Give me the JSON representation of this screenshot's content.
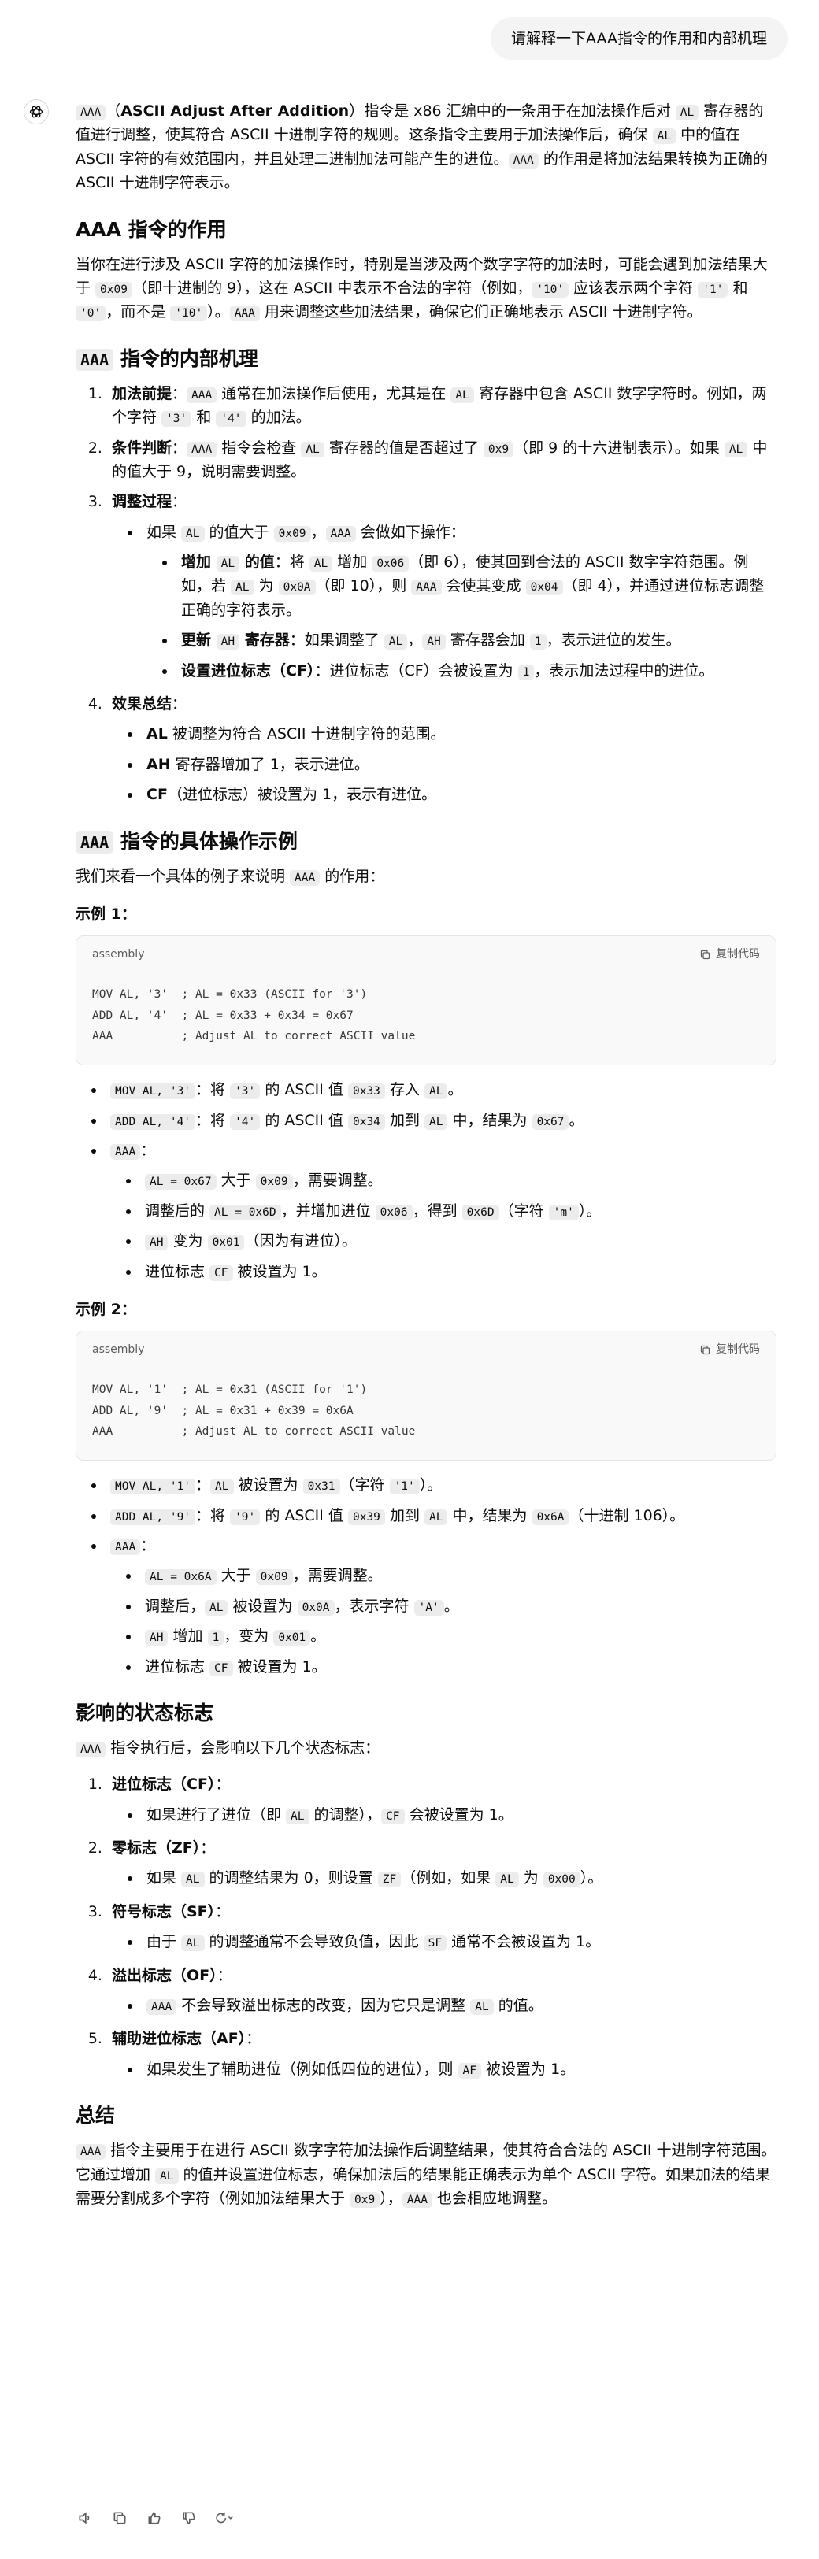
{
  "user_message": "请解释一下AAA指令的作用和内部机理",
  "intro": {
    "code": "AAA",
    "p1": "（",
    "bold": "ASCII Adjust After Addition",
    "p2": "）指令是 x86 汇编中的一条用于在加法操作后对 ",
    "code_al": "AL",
    "p3": " 寄存器的值进行调整，使其符合 ASCII 十进制字符的规则。这条指令主要用于加法操作后，确保 ",
    "code_al2": "AL",
    "p4": " 中的值在 ASCII 字符的有效范围内，并且处理二进制加法可能产生的进位。",
    "code_aaa": "AAA",
    "p5": " 的作用是将加法结果转换为正确的 ASCII 十进制字符表示。"
  },
  "section_role": {
    "title": "AAA 指令的作用",
    "t1": "当你在进行涉及 ASCII 字符的加法操作时，特别是当涉及两个数字字符的加法时，可能会遇到加法结果大于 ",
    "c1": "0x09",
    "t2": "（即十进制的 9），这在 ASCII 中表示不合法的字符（例如，",
    "c2": "'10'",
    "t3": " 应该表示两个字符 ",
    "c3": "'1'",
    "t4": " 和 ",
    "c4": "'0'",
    "t5": "，而不是 ",
    "c5": "'10'",
    "t6": "）。",
    "c6": "AAA",
    "t7": " 用来调整这些加法结果，确保它们正确地表示 ASCII 十进制字符。"
  },
  "section_mech": {
    "title_code": "AAA",
    "title_text": " 指令的内部机理",
    "item1": {
      "bold": "加法前提",
      "t1": "：",
      "c1": "AAA",
      "t2": " 通常在加法操作后使用，尤其是在 ",
      "c2": "AL",
      "t3": " 寄存器中包含 ASCII 数字字符时。例如，两个字符 ",
      "c3": "'3'",
      "t4": " 和 ",
      "c4": "'4'",
      "t5": " 的加法。"
    },
    "item2": {
      "bold": "条件判断",
      "t1": "：",
      "c1": "AAA",
      "t2": " 指令会检查 ",
      "c2": "AL",
      "t3": " 寄存器的值是否超过了 ",
      "c3": "0x9",
      "t4": "（即 9 的十六进制表示）。如果 ",
      "c4": "AL",
      "t5": " 中的值大于 9，说明需要调整。"
    },
    "item3": {
      "bold": "调整过程",
      "t1": "：",
      "sub": {
        "t1": "如果 ",
        "c1": "AL",
        "t2": " 的值大于 ",
        "c2": "0x09",
        "t3": "，",
        "c3": "AAA",
        "t4": " 会做如下操作："
      },
      "s1": {
        "b1": "增加 ",
        "bc": "AL",
        "b2": " 的值",
        "t1": "：将 ",
        "c1": "AL",
        "t2": " 增加 ",
        "c2": "0x06",
        "t3": "（即 6），使其回到合法的 ASCII 数字字符范围。例如，若 ",
        "c3": "AL",
        "t4": " 为 ",
        "c4": "0x0A",
        "t5": "（即 10），则 ",
        "c5": "AAA",
        "t6": " 会使其变成 ",
        "c6": "0x04",
        "t7": "（即 4），并通过进位标志调整正确的字符表示。"
      },
      "s2": {
        "b1": "更新 ",
        "bc": "AH",
        "b2": " 寄存器",
        "t1": "：如果调整了 ",
        "c1": "AL",
        "t2": "，",
        "c2": "AH",
        "t3": " 寄存器会加 ",
        "c3": "1",
        "t4": "，表示进位的发生。"
      },
      "s3": {
        "bold": "设置进位标志（CF）",
        "t1": "：进位标志（CF）会被设置为 ",
        "c1": "1",
        "t2": "，表示加法过程中的进位。"
      }
    },
    "item4": {
      "bold": "效果总结",
      "t1": "：",
      "s1": {
        "bold": "AL",
        "t": " 被调整为符合 ASCII 十进制字符的范围。"
      },
      "s2": {
        "bold": "AH",
        "t": " 寄存器增加了 1，表示进位。"
      },
      "s3": {
        "bold": "CF",
        "t": "（进位标志）被设置为 1，表示有进位。"
      }
    }
  },
  "section_example": {
    "title_code": "AAA",
    "title_text": " 指令的具体操作示例",
    "p1": "我们来看一个具体的例子来说明 ",
    "p1c": "AAA",
    "p2": " 的作用：",
    "ex1": {
      "label": "示例 1：",
      "lang": "assembly",
      "copy": "复制代码",
      "code": "MOV AL, '3'  ; AL = 0x33 (ASCII for '3')\nADD AL, '4'  ; AL = 0x33 + 0x34 = 0x67\nAAA          ; Adjust AL to correct ASCII value",
      "b1": {
        "c1": "MOV AL, '3'",
        "t1": "：将 ",
        "c2": "'3'",
        "t2": " 的 ASCII 值 ",
        "c3": "0x33",
        "t3": " 存入 ",
        "c4": "AL",
        "t4": "。"
      },
      "b2": {
        "c1": "ADD AL, '4'",
        "t1": "：将 ",
        "c2": "'4'",
        "t2": " 的 ASCII 值 ",
        "c3": "0x34",
        "t3": " 加到 ",
        "c4": "AL",
        "t4": " 中，结果为 ",
        "c5": "0x67",
        "t5": "。"
      },
      "b3": {
        "c1": "AAA",
        "t1": "："
      },
      "s1": {
        "c1": "AL = 0x67",
        "t1": " 大于 ",
        "c2": "0x09",
        "t2": "，需要调整。"
      },
      "s2": {
        "t0": "调整后的 ",
        "c1": "AL = 0x6D",
        "t1": "，并增加进位 ",
        "c2": "0x06",
        "t2": "，得到 ",
        "c3": "0x6D",
        "t3": "（字符 ",
        "c4": "'m'",
        "t4": "）。"
      },
      "s3": {
        "c1": "AH",
        "t1": " 变为 ",
        "c2": "0x01",
        "t2": "（因为有进位）。"
      },
      "s4": {
        "t0": "进位标志 ",
        "c1": "CF",
        "t1": " 被设置为 1。"
      }
    },
    "ex2": {
      "label": "示例 2：",
      "lang": "assembly",
      "copy": "复制代码",
      "code": "MOV AL, '1'  ; AL = 0x31 (ASCII for '1')\nADD AL, '9'  ; AL = 0x31 + 0x39 = 0x6A\nAAA          ; Adjust AL to correct ASCII value",
      "b1": {
        "c1": "MOV AL, '1'",
        "t1": "：",
        "c2": "AL",
        "t2": " 被设置为 ",
        "c3": "0x31",
        "t3": "（字符 ",
        "c4": "'1'",
        "t4": "）。"
      },
      "b2": {
        "c1": "ADD AL, '9'",
        "t1": "：将 ",
        "c2": "'9'",
        "t2": " 的 ASCII 值 ",
        "c3": "0x39",
        "t3": " 加到 ",
        "c4": "AL",
        "t4": " 中，结果为 ",
        "c5": "0x6A",
        "t5": "（十进制 106）。"
      },
      "b3": {
        "c1": "AAA",
        "t1": "："
      },
      "s1": {
        "c1": "AL = 0x6A",
        "t1": " 大于 ",
        "c2": "0x09",
        "t2": "，需要调整。"
      },
      "s2": {
        "t0": "调整后，",
        "c1": "AL",
        "t1": " 被设置为 ",
        "c2": "0x0A",
        "t2": "，表示字符 ",
        "c3": "'A'",
        "t3": "。"
      },
      "s3": {
        "c1": "AH",
        "t1": " 增加 ",
        "c2": "1",
        "t2": "，变为 ",
        "c3": "0x01",
        "t3": "。"
      },
      "s4": {
        "t0": "进位标志 ",
        "c1": "CF",
        "t1": " 被设置为 1。"
      }
    }
  },
  "section_flags": {
    "title": "影响的状态标志",
    "p_c": "AAA",
    "p_t": " 指令执行后，会影响以下几个状态标志：",
    "f1": {
      "bold": "进位标志（CF）",
      "t": "：",
      "s_t1": "如果进行了进位（即 ",
      "s_c1": "AL",
      "s_t2": " 的调整），",
      "s_c2": "CF",
      "s_t3": " 会被设置为 1。"
    },
    "f2": {
      "bold": "零标志（ZF）",
      "t": "：",
      "s_t1": "如果 ",
      "s_c1": "AL",
      "s_t2": " 的调整结果为 0，则设置 ",
      "s_c2": "ZF",
      "s_t3": "（例如，如果 ",
      "s_c3": "AL",
      "s_t4": " 为 ",
      "s_c4": "0x00",
      "s_t5": "）。"
    },
    "f3": {
      "bold": "符号标志（SF）",
      "t": "：",
      "s_t1": "由于 ",
      "s_c1": "AL",
      "s_t2": " 的调整通常不会导致负值，因此 ",
      "s_c2": "SF",
      "s_t3": " 通常不会被设置为 1。"
    },
    "f4": {
      "bold": "溢出标志（OF）",
      "t": "：",
      "s_c1": "AAA",
      "s_t1": " 不会导致溢出标志的改变，因为它只是调整 ",
      "s_c2": "AL",
      "s_t2": " 的值。"
    },
    "f5": {
      "bold": "辅助进位标志（AF）",
      "t": "：",
      "s_t1": "如果发生了辅助进位（例如低四位的进位），则 ",
      "s_c1": "AF",
      "s_t2": " 被设置为 1。"
    }
  },
  "section_summary": {
    "title": "总结",
    "c1": "AAA",
    "t1": " 指令主要用于在进行 ASCII 数字字符加法操作后调整结果，使其符合合法的 ASCII 十进制字符范围。它通过增加 ",
    "c2": "AL",
    "t2": " 的值并设置进位标志，确保加法后的结果能正确表示为单个 ASCII 字符。如果加法的结果需要分割成多个字符（例如加法结果大于 ",
    "c3": "0x9",
    "t3": "），",
    "c4": "AAA",
    "t4": " 也会相应地调整。"
  },
  "actions": [
    "speaker-icon",
    "copy-icon",
    "thumbs-up-icon",
    "thumbs-down-icon",
    "regenerate-icon"
  ]
}
